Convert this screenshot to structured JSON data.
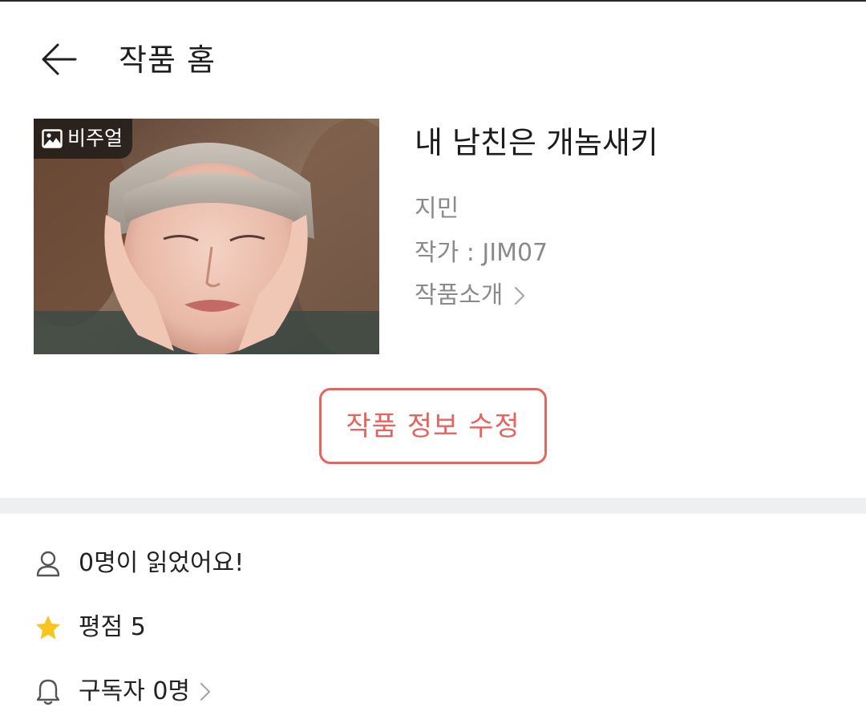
{
  "header": {
    "title": "작품 홈"
  },
  "work": {
    "visual_badge": "비주얼",
    "title": "내 남친은 개놈새키",
    "subtitle": "지민",
    "author": "작가 : JIM07",
    "intro_link": "작품소개"
  },
  "edit_button": {
    "label": "작품 정보 수정"
  },
  "stats": {
    "readers": "0명이 읽었어요!",
    "rating": "평점 5",
    "subscribers": "구독자 0명"
  },
  "icons": {
    "back": "arrow-left-icon",
    "badge": "image-icon",
    "intro": "chevron-right-icon",
    "readers": "person-icon",
    "rating": "star-icon",
    "subscribers": "bell-icon"
  },
  "colors": {
    "accent": "#e5645e",
    "star": "#f7c51e",
    "muted_text": "#8a8a8a",
    "divider": "#eeeff1"
  }
}
